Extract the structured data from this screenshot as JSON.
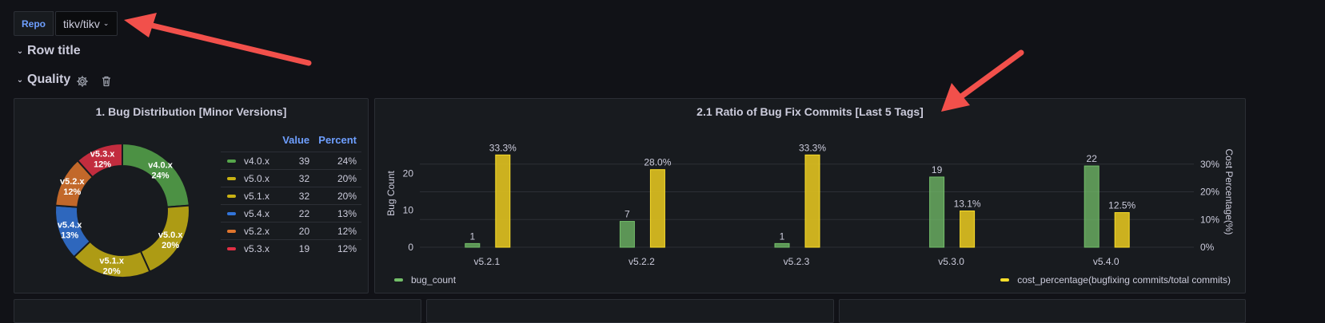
{
  "variable": {
    "label": "Repo",
    "value": "tikv/tikv"
  },
  "rows": [
    {
      "title": "Row title"
    },
    {
      "title": "Quality"
    }
  ],
  "pie_panel": {
    "title": "1. Bug Distribution [Minor Versions]",
    "legend_headers": {
      "value": "Value",
      "percent": "Percent"
    }
  },
  "bar_panel": {
    "title": "2.1 Ratio of Bug Fix Commits [Last 5 Tags]",
    "y_left_label": "Bug Count",
    "y_right_label": "Cost Percentage(%)",
    "legend": [
      "bug_count",
      "cost_percentage(bugfixing commits/total commits)"
    ]
  },
  "colors": {
    "accent_blue": "#6e9fff",
    "arrow": "#f2504b",
    "green": "#73bf69",
    "yellow": "#fade2a"
  },
  "chart_data": [
    {
      "type": "pie",
      "donut": true,
      "title": "1. Bug Distribution [Minor Versions]",
      "slices": [
        {
          "label": "v4.0.x",
          "value": 39,
          "percent": "24%",
          "color": "#56a64b"
        },
        {
          "label": "v5.0.x",
          "value": 32,
          "percent": "20%",
          "color": "#c8b213"
        },
        {
          "label": "v5.1.x",
          "value": 32,
          "percent": "20%",
          "color": "#c9b114"
        },
        {
          "label": "v5.4.x",
          "value": 22,
          "percent": "13%",
          "color": "#3274d9"
        },
        {
          "label": "v5.2.x",
          "value": 20,
          "percent": "12%",
          "color": "#e0752d"
        },
        {
          "label": "v5.3.x",
          "value": 19,
          "percent": "12%",
          "color": "#e02f44"
        }
      ],
      "legend_placement": "right"
    },
    {
      "type": "bar",
      "title": "2.1 Ratio of Bug Fix Commits [Last 5 Tags]",
      "categories": [
        "v5.2.1",
        "v5.2.2",
        "v5.2.3",
        "v5.3.0",
        "v5.4.0"
      ],
      "series": [
        {
          "name": "bug_count",
          "values": [
            1,
            7,
            1,
            19,
            22
          ],
          "labels": [
            "1",
            "7",
            "1",
            "19",
            "22"
          ],
          "axis": "left",
          "color": "#73bf69"
        },
        {
          "name": "cost_percentage(bugfixing commits/total commits)",
          "values": [
            33.3,
            28.0,
            33.3,
            13.1,
            12.5
          ],
          "labels": [
            "33.3%",
            "28.0%",
            "33.3%",
            "13.1%",
            "12.5%"
          ],
          "axis": "right",
          "color": "#fade2a"
        }
      ],
      "ylabel": "Bug Count",
      "ylabel_right": "Cost Percentage(%)",
      "yticks_left": [
        "0",
        "10",
        "20"
      ],
      "yticks_right": [
        "0%",
        "10%",
        "20%",
        "30%"
      ],
      "ylim_left": [
        0,
        30
      ],
      "ylim_right": [
        0,
        40
      ],
      "grid": true,
      "legend_placement": "bottom"
    }
  ]
}
